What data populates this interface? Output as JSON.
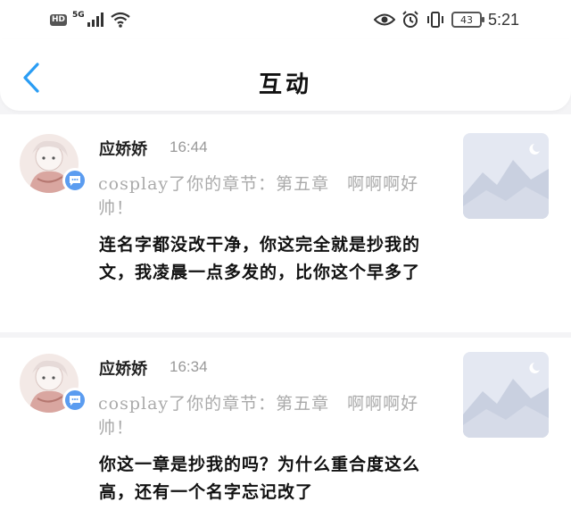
{
  "status_bar": {
    "hd": "HD",
    "network": "5G",
    "battery": "43",
    "time": "5:21",
    "icons": [
      "signal-icon",
      "wifi-icon",
      "eye-icon",
      "alarm-icon",
      "vibrate-icon",
      "battery-icon"
    ]
  },
  "header": {
    "title": "互动",
    "back_icon": "chevron-left-icon"
  },
  "colors": {
    "accent": "#2a9df4",
    "badge": "#5b9cf0",
    "muted_text": "#aaaaaa",
    "background": "#f4f4f6"
  },
  "items": [
    {
      "name": "应娇娇",
      "time": "16:44",
      "notice": "cosplay了你的章节：第五章　啊啊啊好帅！",
      "comment": "连名字都没改干净，你这完全就是抄我的文，我凌晨一点多发的，比你这个早多了"
    },
    {
      "name": "应娇娇",
      "time": "16:34",
      "notice": "cosplay了你的章节：第五章　啊啊啊好帅！",
      "comment": "你这一章是抄我的吗？为什么重合度这么高，还有一个名字忘记改了"
    }
  ]
}
